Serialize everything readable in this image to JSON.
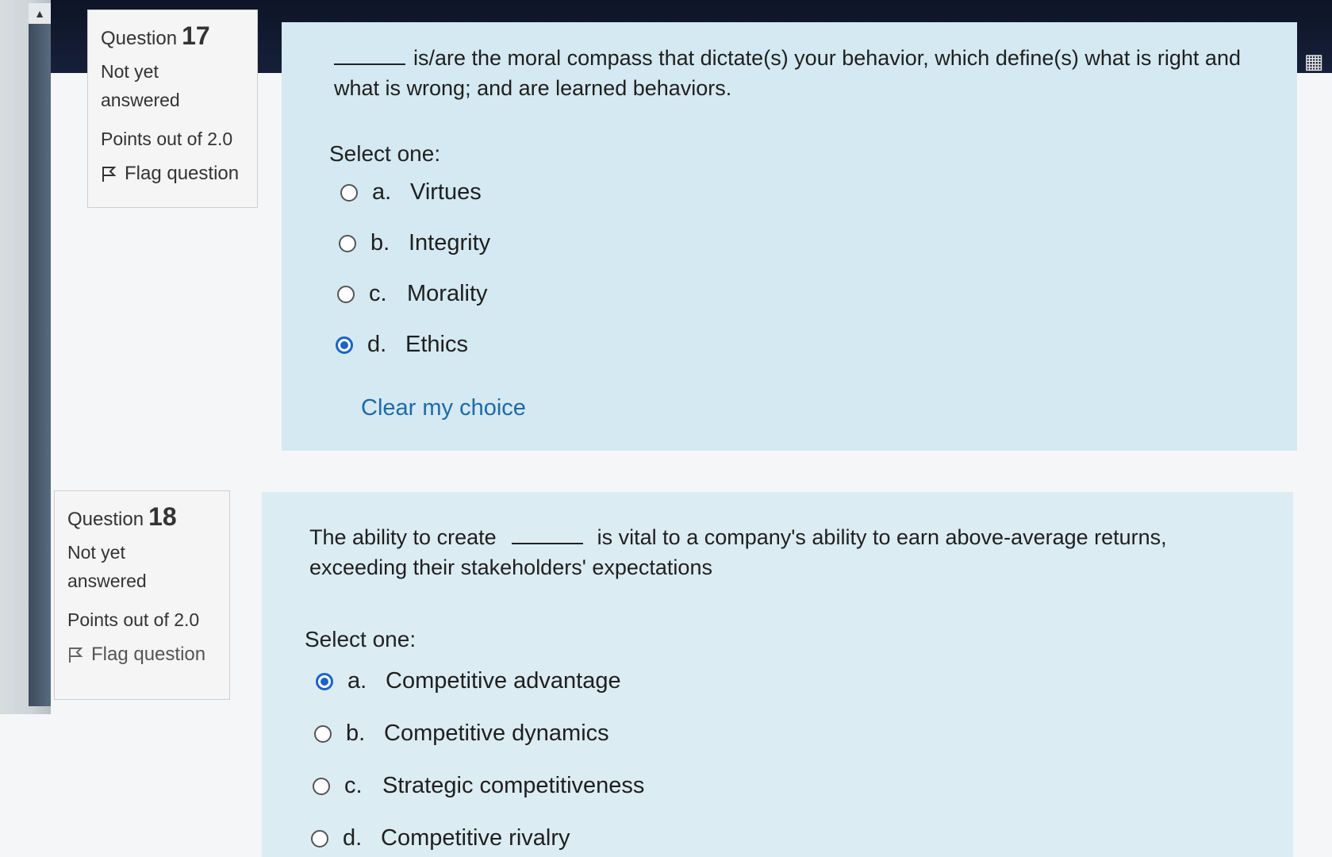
{
  "icons": {
    "grid": "grid-icon",
    "flag": "flag-icon",
    "scroll_up": "scroll-up-arrow-icon"
  },
  "questions": [
    {
      "label": "Question",
      "number": "17",
      "state_line1": "Not yet",
      "state_line2": "answered",
      "points": "Points out of 2.0",
      "flag_label": "Flag question",
      "text_line1": "is/are the moral compass that dictate(s) your behavior, which define(s) what is right and",
      "text_line2": "what is wrong; and are learned behaviors.",
      "select_label": "Select one:",
      "options": [
        {
          "letter": "a.",
          "text": "Virtues",
          "selected": false
        },
        {
          "letter": "b.",
          "text": "Integrity",
          "selected": false
        },
        {
          "letter": "c.",
          "text": "Morality",
          "selected": false
        },
        {
          "letter": "d.",
          "text": "Ethics",
          "selected": true
        }
      ],
      "clear_label": "Clear my choice"
    },
    {
      "label": "Question",
      "number": "18",
      "state_line1": "Not yet",
      "state_line2": "answered",
      "points": "Points out of 2.0",
      "flag_label": "Flag question",
      "text_before_blank": "The ability to create",
      "text_after_blank": "is vital to a company's ability to earn above-average returns,",
      "text_line2": "exceeding their stakeholders' expectations",
      "select_label": "Select one:",
      "options": [
        {
          "letter": "a.",
          "text": "Competitive advantage",
          "selected": true
        },
        {
          "letter": "b.",
          "text": "Competitive dynamics",
          "selected": false
        },
        {
          "letter": "c.",
          "text": "Strategic competitiveness",
          "selected": false
        },
        {
          "letter": "d.",
          "text": "Competitive rivalry",
          "selected": false
        }
      ]
    }
  ]
}
